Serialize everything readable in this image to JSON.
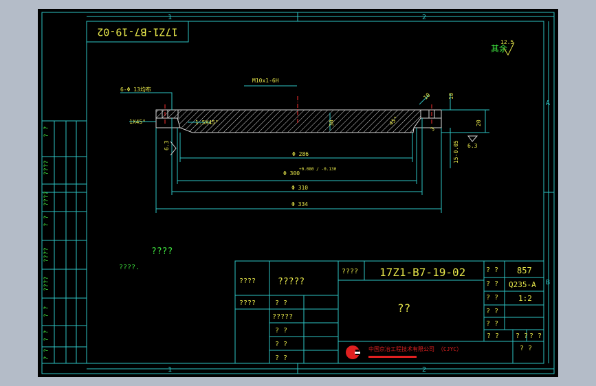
{
  "colors": {
    "background": "#b4bcc8",
    "sheet": "#000000",
    "frame": "#2ec6c6",
    "part": "#d8d8d8",
    "dimension": "#2ec6c6",
    "text_yellow": "#e6e64a",
    "text_green": "#3ee03e",
    "centerline": "#ff3030",
    "logo": "#e02020"
  },
  "grid_labels": {
    "top_1": "1",
    "top_2": "2",
    "bottom_1": "1",
    "bottom_2": "2",
    "right_a": "A",
    "right_b": "B"
  },
  "drawing_number_box": "17Z1-B7-19-02",
  "roughness_note": {
    "text": "其余",
    "value": "12.5"
  },
  "annotations": {
    "bolt_holes": "6-Φ 13均布",
    "thread": "M10x1-6H",
    "chamfer_left": "1X45°",
    "chamfer_inner": "1.5X45°",
    "thickness_30": "30",
    "angle_45": "45°",
    "depth_10": "10",
    "dim_20": "20",
    "dim_3": "3",
    "roughness_left": "6.3",
    "roughness_right": "6.3",
    "dim_15": "15-0.05",
    "dim_10b": "10",
    "chamfer_right": "R5"
  },
  "dimensions": {
    "d1": "Φ 286",
    "d2": "Φ 300",
    "d2_tol": "+0.080 / -0.130",
    "d3": "Φ 310",
    "d4": "Φ 334"
  },
  "notes": {
    "note1": "????",
    "note2": "????."
  },
  "title_block": {
    "r1c1": "????",
    "r1c2": "?????",
    "r2c1": "????",
    "r2c2": "? ?",
    "r3c2": "?????",
    "r4c2": "? ?",
    "r5c2": "? ?",
    "r6c2": "? ?",
    "drawing_label": "????",
    "drawing_no": "17Z1-B7-19-02",
    "part_name": "??",
    "qty_label": "? ?",
    "qty_value": "857",
    "material_label": "? ?",
    "material_value": "Q235-A",
    "scale_label": "? ?",
    "scale_value": "1:2",
    "weight_label": "? ?",
    "sheet_label": "? ?",
    "row5_a": "? ?",
    "row5_b": "? ?",
    "row5_c": "? ?",
    "company_cn": "中国京冶工程技术有限公司 （CJYC）",
    "company_sub": "? ?"
  },
  "left_strip": [
    "? ?",
    "????",
    "????",
    "? ?",
    "????",
    "????",
    "? ?",
    "? ?",
    "?   ?"
  ]
}
